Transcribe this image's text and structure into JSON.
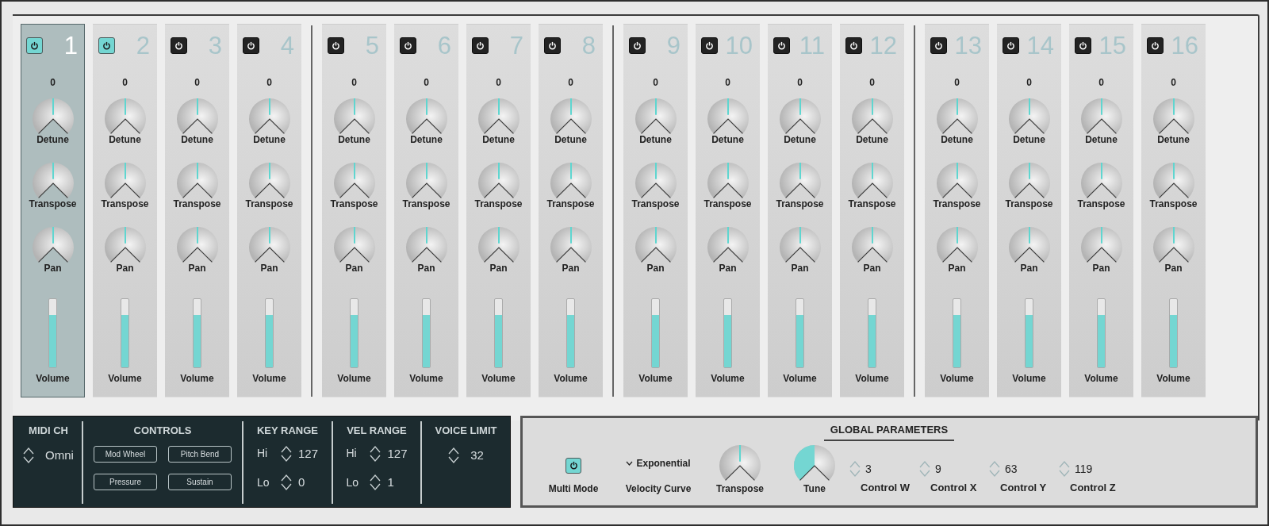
{
  "channels": [
    {
      "number": "1",
      "power": true,
      "selected": true,
      "value": "0",
      "knobs": [
        {
          "label": "Detune",
          "level": 0.5
        },
        {
          "label": "Transpose",
          "level": 0.5
        },
        {
          "label": "Pan",
          "level": 0.5
        }
      ],
      "volume": {
        "label": "Volume",
        "level": 0.77
      }
    },
    {
      "number": "2",
      "power": true,
      "selected": false,
      "value": "0",
      "knobs": [
        {
          "label": "Detune",
          "level": 0.5
        },
        {
          "label": "Transpose",
          "level": 0.5
        },
        {
          "label": "Pan",
          "level": 0.5
        }
      ],
      "volume": {
        "label": "Volume",
        "level": 0.77
      }
    },
    {
      "number": "3",
      "power": false,
      "selected": false,
      "value": "0",
      "knobs": [
        {
          "label": "Detune",
          "level": 0.5
        },
        {
          "label": "Transpose",
          "level": 0.5
        },
        {
          "label": "Pan",
          "level": 0.5
        }
      ],
      "volume": {
        "label": "Volume",
        "level": 0.77
      }
    },
    {
      "number": "4",
      "power": false,
      "selected": false,
      "value": "0",
      "knobs": [
        {
          "label": "Detune",
          "level": 0.5
        },
        {
          "label": "Transpose",
          "level": 0.5
        },
        {
          "label": "Pan",
          "level": 0.5
        }
      ],
      "volume": {
        "label": "Volume",
        "level": 0.77
      }
    },
    {
      "number": "5",
      "power": false,
      "selected": false,
      "value": "0",
      "knobs": [
        {
          "label": "Detune",
          "level": 0.5
        },
        {
          "label": "Transpose",
          "level": 0.5
        },
        {
          "label": "Pan",
          "level": 0.5
        }
      ],
      "volume": {
        "label": "Volume",
        "level": 0.77
      }
    },
    {
      "number": "6",
      "power": false,
      "selected": false,
      "value": "0",
      "knobs": [
        {
          "label": "Detune",
          "level": 0.5
        },
        {
          "label": "Transpose",
          "level": 0.5
        },
        {
          "label": "Pan",
          "level": 0.5
        }
      ],
      "volume": {
        "label": "Volume",
        "level": 0.77
      }
    },
    {
      "number": "7",
      "power": false,
      "selected": false,
      "value": "0",
      "knobs": [
        {
          "label": "Detune",
          "level": 0.5
        },
        {
          "label": "Transpose",
          "level": 0.5
        },
        {
          "label": "Pan",
          "level": 0.5
        }
      ],
      "volume": {
        "label": "Volume",
        "level": 0.77
      }
    },
    {
      "number": "8",
      "power": false,
      "selected": false,
      "value": "0",
      "knobs": [
        {
          "label": "Detune",
          "level": 0.5
        },
        {
          "label": "Transpose",
          "level": 0.5
        },
        {
          "label": "Pan",
          "level": 0.5
        }
      ],
      "volume": {
        "label": "Volume",
        "level": 0.77
      }
    },
    {
      "number": "9",
      "power": false,
      "selected": false,
      "value": "0",
      "knobs": [
        {
          "label": "Detune",
          "level": 0.5
        },
        {
          "label": "Transpose",
          "level": 0.5
        },
        {
          "label": "Pan",
          "level": 0.5
        }
      ],
      "volume": {
        "label": "Volume",
        "level": 0.77
      }
    },
    {
      "number": "10",
      "power": false,
      "selected": false,
      "value": "0",
      "knobs": [
        {
          "label": "Detune",
          "level": 0.5
        },
        {
          "label": "Transpose",
          "level": 0.5
        },
        {
          "label": "Pan",
          "level": 0.5
        }
      ],
      "volume": {
        "label": "Volume",
        "level": 0.77
      }
    },
    {
      "number": "11",
      "power": false,
      "selected": false,
      "value": "0",
      "knobs": [
        {
          "label": "Detune",
          "level": 0.5
        },
        {
          "label": "Transpose",
          "level": 0.5
        },
        {
          "label": "Pan",
          "level": 0.5
        }
      ],
      "volume": {
        "label": "Volume",
        "level": 0.77
      }
    },
    {
      "number": "12",
      "power": false,
      "selected": false,
      "value": "0",
      "knobs": [
        {
          "label": "Detune",
          "level": 0.5
        },
        {
          "label": "Transpose",
          "level": 0.5
        },
        {
          "label": "Pan",
          "level": 0.5
        }
      ],
      "volume": {
        "label": "Volume",
        "level": 0.77
      }
    },
    {
      "number": "13",
      "power": false,
      "selected": false,
      "value": "0",
      "knobs": [
        {
          "label": "Detune",
          "level": 0.5
        },
        {
          "label": "Transpose",
          "level": 0.5
        },
        {
          "label": "Pan",
          "level": 0.5
        }
      ],
      "volume": {
        "label": "Volume",
        "level": 0.77
      }
    },
    {
      "number": "14",
      "power": false,
      "selected": false,
      "value": "0",
      "knobs": [
        {
          "label": "Detune",
          "level": 0.5
        },
        {
          "label": "Transpose",
          "level": 0.5
        },
        {
          "label": "Pan",
          "level": 0.5
        }
      ],
      "volume": {
        "label": "Volume",
        "level": 0.77
      }
    },
    {
      "number": "15",
      "power": false,
      "selected": false,
      "value": "0",
      "knobs": [
        {
          "label": "Detune",
          "level": 0.5
        },
        {
          "label": "Transpose",
          "level": 0.5
        },
        {
          "label": "Pan",
          "level": 0.5
        }
      ],
      "volume": {
        "label": "Volume",
        "level": 0.77
      }
    },
    {
      "number": "16",
      "power": false,
      "selected": false,
      "value": "0",
      "knobs": [
        {
          "label": "Detune",
          "level": 0.5
        },
        {
          "label": "Transpose",
          "level": 0.5
        },
        {
          "label": "Pan",
          "level": 0.5
        }
      ],
      "volume": {
        "label": "Volume",
        "level": 0.77
      }
    }
  ],
  "channel_settings": [
    {
      "kind": "stepper",
      "title": "MIDI CH",
      "value": "Omni"
    },
    {
      "kind": "buttons",
      "title": "CONTROLS",
      "buttons": [
        "Mod Wheel",
        "Pitch Bend",
        "Pressure",
        "Sustain"
      ]
    },
    {
      "kind": "range",
      "title": "KEY RANGE",
      "rows": [
        {
          "label": "Hi",
          "value": "127"
        },
        {
          "label": "Lo",
          "value": "0"
        }
      ]
    },
    {
      "kind": "range",
      "title": "VEL RANGE",
      "rows": [
        {
          "label": "Hi",
          "value": "127"
        },
        {
          "label": "Lo",
          "value": "1"
        }
      ]
    },
    {
      "kind": "stepper",
      "title": "VOICE LIMIT",
      "value": "32"
    }
  ],
  "global_parameters": {
    "title": "GLOBAL PARAMETERS",
    "multi_mode": {
      "label": "Multi Mode",
      "on": true
    },
    "velocity_curve": {
      "label": "Velocity Curve",
      "value": "Exponential"
    },
    "knobs": [
      {
        "kind": "pointer",
        "label": "Transpose",
        "level": 0.5
      },
      {
        "kind": "filled",
        "label": "Tune",
        "level": 0.5
      }
    ],
    "controls": [
      {
        "label": "Control W",
        "value": "3"
      },
      {
        "label": "Control X",
        "value": "9"
      },
      {
        "label": "Control Y",
        "value": "63"
      },
      {
        "label": "Control Z",
        "value": "119"
      }
    ]
  }
}
